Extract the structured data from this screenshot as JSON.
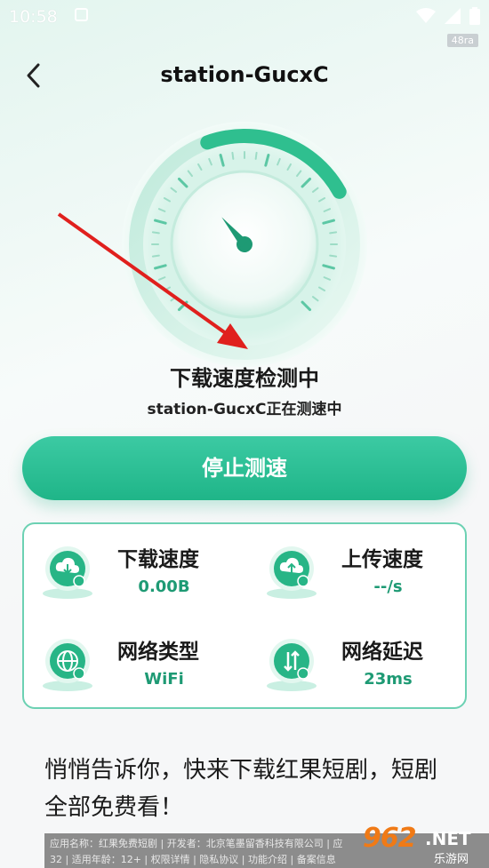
{
  "status_bar": {
    "time": "10:58"
  },
  "corner_badge": "48ra",
  "nav": {
    "title": "station-GucxC"
  },
  "test": {
    "heading": "下载速度检测中",
    "subtitle": "station-GucxC正在测速中",
    "progress": 0.3
  },
  "stop_button": {
    "label": "停止测速"
  },
  "stats": {
    "download": {
      "label": "下载速度",
      "value": "0.00B"
    },
    "upload": {
      "label": "上传速度",
      "value": "--/s"
    },
    "network_type": {
      "label": "网络类型",
      "value": "WiFi"
    },
    "latency": {
      "label": "网络延迟",
      "value": "23ms"
    }
  },
  "promo": {
    "text": "悄悄告诉你，快来下载红果短剧，短剧全部免费看！"
  },
  "footer": {
    "line1": "应用名称：红果免费短剧 | 开发者：北京笔墨留香科技有限公司 | 应",
    "line2": "32 | 适用年龄：12+ | 权限详情 | 隐私协议 | 功能介绍 | 备案信息"
  },
  "watermark": {
    "number": "962",
    "net": ".NET",
    "sub": "乐游网"
  },
  "colors": {
    "accent": "#22b98b",
    "value_green": "#1e9a74",
    "card_border": "#6cd1b3",
    "arrow": "#e0201d"
  }
}
